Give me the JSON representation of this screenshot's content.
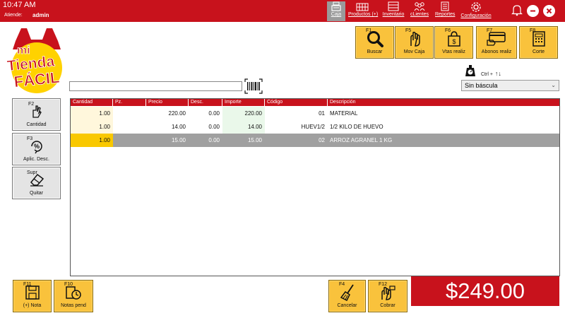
{
  "topbar": {
    "time": "10:47 AM",
    "attending_label": "Atiende:",
    "user": "admin",
    "nav": [
      {
        "label": "Caja",
        "icon": "cash-register-icon"
      },
      {
        "label": "Productos (+)",
        "icon": "products-icon"
      },
      {
        "label": "Inventario",
        "icon": "inventory-icon"
      },
      {
        "label": "cLientes",
        "icon": "clients-icon"
      },
      {
        "label": "Reportes",
        "icon": "reports-icon"
      },
      {
        "label": "Configuración",
        "icon": "gear-icon"
      }
    ],
    "active_nav": "Caja"
  },
  "logo": {
    "line1": "mi",
    "line2": "Tienda",
    "line3": "FÁCIL"
  },
  "function_buttons": [
    {
      "key": "F1",
      "label": "Buscar",
      "icon": "search-icon"
    },
    {
      "key": "F5",
      "label": "Mov Caja",
      "icon": "cash-movement-icon"
    },
    {
      "key": "F6",
      "label": "Vtas realiz",
      "icon": "sales-bag-icon"
    },
    {
      "key": "F7",
      "label": "Abonos realiz",
      "icon": "card-payment-icon"
    },
    {
      "key": "F8",
      "label": "Corte",
      "icon": "calculator-icon"
    }
  ],
  "side_buttons": [
    {
      "key": "F2",
      "label": "Cantidad",
      "icon": "quantity-icon"
    },
    {
      "key": "F3",
      "label": "Aplic. Desc.",
      "icon": "discount-icon"
    },
    {
      "key": "Supr",
      "label": "Quitar",
      "icon": "eraser-icon"
    }
  ],
  "search": {
    "value": "",
    "placeholder": ""
  },
  "scale": {
    "shortcut": "Ctrl +",
    "arrows": "↑↓",
    "selected": "Sin báscula"
  },
  "table": {
    "columns": [
      "Cantidad",
      "Pz.",
      "Precio",
      "Desc.",
      "Importe",
      "Código",
      "Descripción"
    ],
    "rows": [
      {
        "cantidad": "1.00",
        "pz": "",
        "precio": "220.00",
        "desc": "0.00",
        "importe": "220.00",
        "codigo": "01",
        "descripcion": "MATERIAL"
      },
      {
        "cantidad": "1.00",
        "pz": "",
        "precio": "14.00",
        "desc": "0.00",
        "importe": "14.00",
        "codigo": "HUEV1/2",
        "descripcion": "1/2 KILO DE HUEVO"
      },
      {
        "cantidad": "1.00",
        "pz": "",
        "precio": "15.00",
        "desc": "0.00",
        "importe": "15.00",
        "codigo": "02",
        "descripcion": "ARROZ AGRANEL 1 KG"
      }
    ],
    "selected_row": 3
  },
  "bottom_buttons": [
    {
      "key": "F11",
      "label": "(+) Nota",
      "icon": "save-note-icon"
    },
    {
      "key": "F10",
      "label": "Notas pend",
      "icon": "pending-notes-icon"
    },
    {
      "key": "F4",
      "label": "Cancelar",
      "icon": "broom-icon"
    },
    {
      "key": "F12",
      "label": "Cobrar",
      "icon": "pay-hand-icon"
    }
  ],
  "total": "$249.00",
  "colors": {
    "brand_red": "#c8121c",
    "button_yellow": "#f9c23c",
    "selection_grey": "#a0a0a0"
  }
}
